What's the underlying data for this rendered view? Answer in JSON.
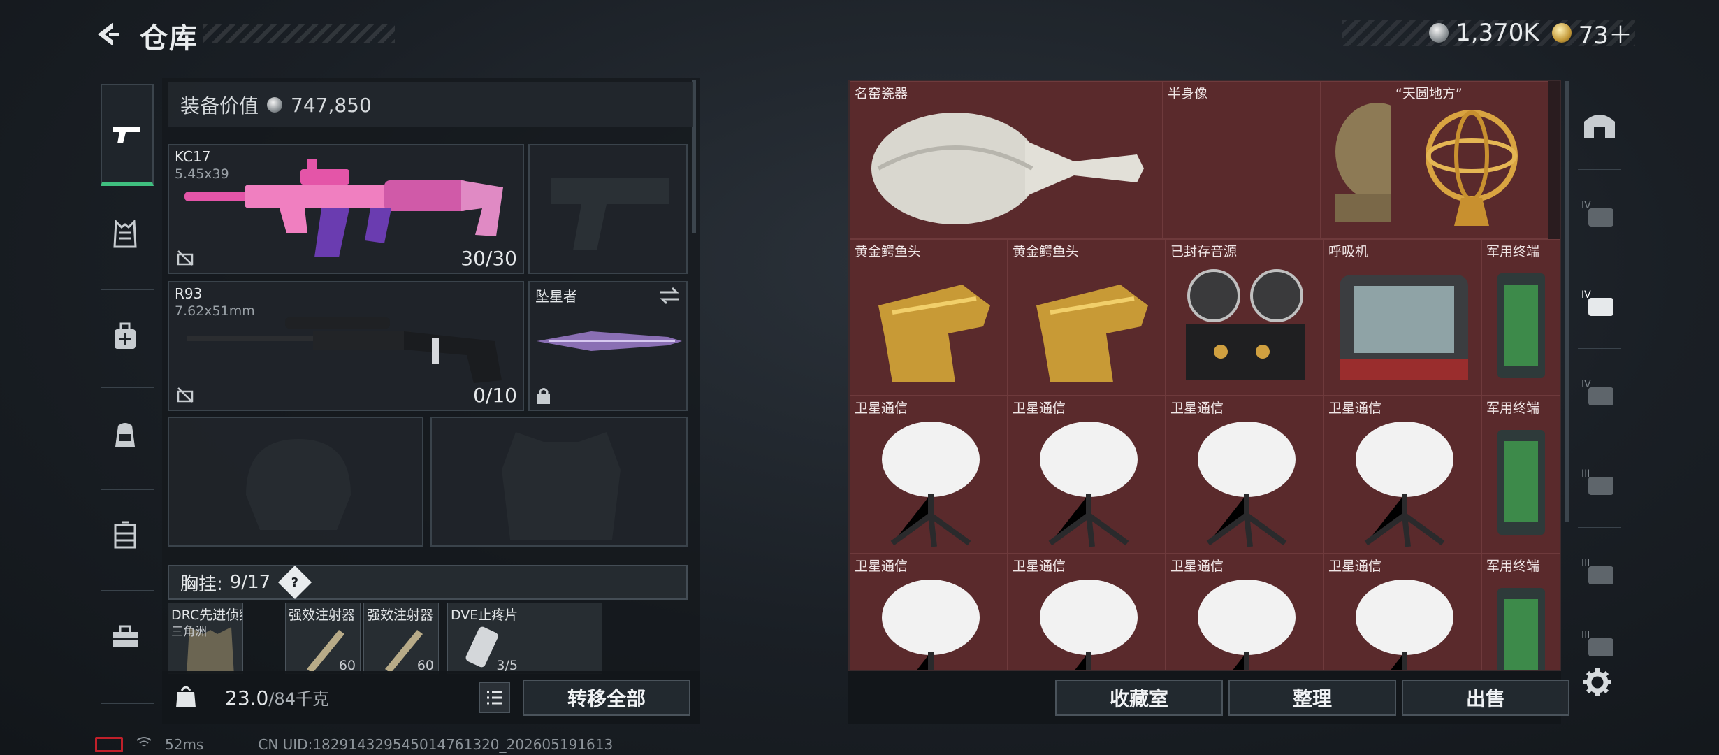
{
  "header": {
    "title": "仓库",
    "currency": [
      {
        "icon": "silver-coin-icon",
        "value": "1,370K"
      },
      {
        "icon": "gold-coin-icon",
        "value": "73＋"
      }
    ]
  },
  "sidenav": {
    "items": [
      {
        "icon": "pistol-icon",
        "active": true
      },
      {
        "icon": "chest-rig-icon",
        "active": false
      },
      {
        "icon": "medic-bag-icon",
        "active": false
      },
      {
        "icon": "backpack-icon",
        "active": false
      },
      {
        "icon": "storage-box-icon",
        "active": false
      },
      {
        "icon": "toolbox-icon",
        "active": false
      }
    ]
  },
  "loadout": {
    "equip_value_label": "装备价值",
    "equip_value": "747,850",
    "primary": {
      "name": "KC17",
      "caliber": "5.45x39",
      "ammo": "30/30"
    },
    "secondary": {
      "name": "R93",
      "caliber": "7.62x51mm",
      "ammo": "0/10"
    },
    "melee": {
      "name": "坠星者"
    },
    "chest": {
      "label": "胸挂:",
      "count": "9/17",
      "help": "?"
    },
    "chest_items": [
      {
        "name": "DRC先进侦察...",
        "sub": "三角洲",
        "count": ""
      },
      {
        "name": "强效注射器",
        "sub": "",
        "count": "60"
      },
      {
        "name": "强效注射器",
        "sub": "",
        "count": "60"
      },
      {
        "name": "DVE止疼片",
        "sub": "",
        "count": "3/5"
      }
    ],
    "weight": "23.0",
    "weight_max": "/84千克",
    "transfer_all": "转移全部"
  },
  "storage": {
    "items": [
      {
        "name": "名窑瓷器"
      },
      {
        "name": "半身像"
      },
      {
        "name": "“天圆地方”"
      },
      {
        "name": "黄金鳄鱼头"
      },
      {
        "name": "黄金鳄鱼头"
      },
      {
        "name": "已封存音源"
      },
      {
        "name": "呼吸机"
      },
      {
        "name": "军用终端"
      },
      {
        "name": "卫星通信"
      },
      {
        "name": "卫星通信"
      },
      {
        "name": "卫星通信"
      },
      {
        "name": "卫星通信"
      },
      {
        "name": "军用终端"
      },
      {
        "name": "卫星通信"
      },
      {
        "name": "卫星通信"
      },
      {
        "name": "卫星通信"
      },
      {
        "name": "卫星通信"
      },
      {
        "name": "军用终端"
      }
    ],
    "buttons": {
      "collection": "收藏室",
      "organize": "整理",
      "sell": "出售"
    }
  },
  "right_tabs": [
    "safehouse-icon",
    "IV",
    "IV",
    "IV",
    "III",
    "III",
    "III"
  ],
  "footer": {
    "ping": "52ms",
    "uid": "CN UID:18291432954501476132​0_202605191613"
  }
}
